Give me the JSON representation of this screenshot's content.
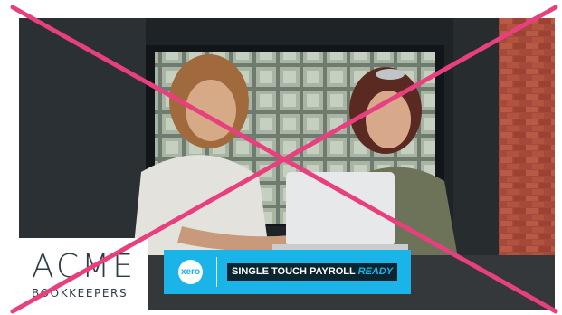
{
  "brand": {
    "name_line1": "ACME",
    "name_line2": "BOOKKEEPERS"
  },
  "banner": {
    "xero_logo_text": "xero",
    "label": "SINGLE TOUCH PAYROLL",
    "label_emphasis": "READY"
  },
  "colors": {
    "banner_blue": "#1ab4e8",
    "label_dark": "#0a2430",
    "crossout_pink": "#e8407f",
    "brand_text": "#2d3b43"
  }
}
